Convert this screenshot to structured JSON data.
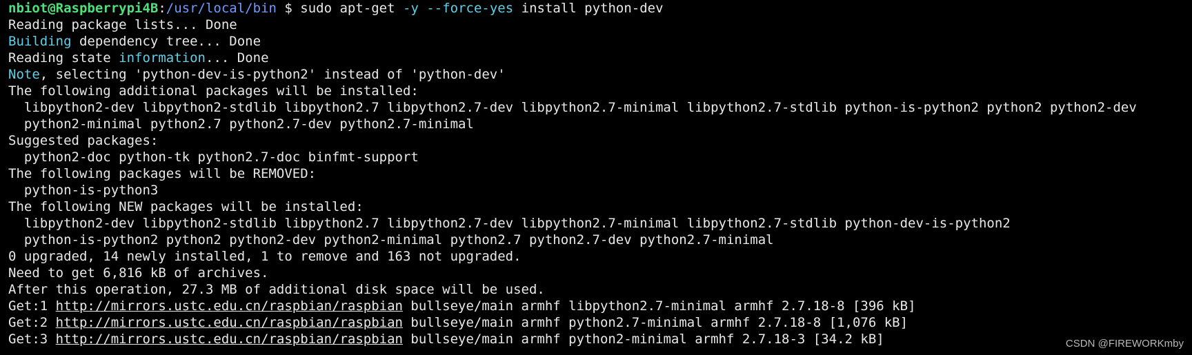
{
  "terminal": {
    "lines": [
      [
        {
          "t": "nbiot@Raspberrypi4B",
          "s": "prompt-user"
        },
        {
          "t": ":",
          "s": "text"
        },
        {
          "t": "/usr/local/bin",
          "s": "prompt-path"
        },
        {
          "t": " $ ",
          "s": "text"
        },
        {
          "t": "sudo apt-get ",
          "s": "text"
        },
        {
          "t": "-y",
          "s": "flag"
        },
        {
          "t": " ",
          "s": "text"
        },
        {
          "t": "--force-yes",
          "s": "flag"
        },
        {
          "t": " install python-dev",
          "s": "text"
        }
      ],
      [
        {
          "t": "Reading package lists... Done",
          "s": "text"
        }
      ],
      [
        {
          "t": "Building",
          "s": "key"
        },
        {
          "t": " dependency tree... Done",
          "s": "text"
        }
      ],
      [
        {
          "t": "Reading state ",
          "s": "text"
        },
        {
          "t": "information",
          "s": "key"
        },
        {
          "t": "... Done",
          "s": "text"
        }
      ],
      [
        {
          "t": "Note",
          "s": "key"
        },
        {
          "t": ", selecting 'python-dev-is-python2' instead of 'python-dev'",
          "s": "text"
        }
      ],
      [
        {
          "t": "The following additional packages will be installed:",
          "s": "text"
        }
      ],
      [
        {
          "t": "  libpython2-dev libpython2-stdlib libpython2.7 libpython2.7-dev libpython2.7-minimal libpython2.7-stdlib python-is-python2 python2 python2-dev",
          "s": "text"
        }
      ],
      [
        {
          "t": "  python2-minimal python2.7 python2.7-dev python2.7-minimal",
          "s": "text"
        }
      ],
      [
        {
          "t": "Suggested packages:",
          "s": "text"
        }
      ],
      [
        {
          "t": "  python2-doc python-tk python2.7-doc binfmt-support",
          "s": "text"
        }
      ],
      [
        {
          "t": "The following packages will be REMOVED:",
          "s": "text"
        }
      ],
      [
        {
          "t": "  python-is-python3",
          "s": "text"
        }
      ],
      [
        {
          "t": "The following NEW packages will be installed:",
          "s": "text"
        }
      ],
      [
        {
          "t": "  libpython2-dev libpython2-stdlib libpython2.7 libpython2.7-dev libpython2.7-minimal libpython2.7-stdlib python-dev-is-python2",
          "s": "text"
        }
      ],
      [
        {
          "t": "  python-is-python2 python2 python2-dev python2-minimal python2.7 python2.7-dev python2.7-minimal",
          "s": "text"
        }
      ],
      [
        {
          "t": "0 upgraded, 14 newly installed, 1 to remove and 163 not upgraded.",
          "s": "text"
        }
      ],
      [
        {
          "t": "Need to get 6,816 kB of archives.",
          "s": "text"
        }
      ],
      [
        {
          "t": "After this operation, 27.3 MB of additional disk space will be used.",
          "s": "text"
        }
      ],
      [
        {
          "t": "Get:1 ",
          "s": "text"
        },
        {
          "t": "http://mirrors.ustc.edu.cn/raspbian/raspbian",
          "s": "link"
        },
        {
          "t": " bullseye/main armhf libpython2.7-minimal armhf 2.7.18-8 [396 kB]",
          "s": "text"
        }
      ],
      [
        {
          "t": "Get:2 ",
          "s": "text"
        },
        {
          "t": "http://mirrors.ustc.edu.cn/raspbian/raspbian",
          "s": "link"
        },
        {
          "t": " bullseye/main armhf python2.7-minimal armhf 2.7.18-8 [1,076 kB]",
          "s": "text"
        }
      ],
      [
        {
          "t": "Get:3 ",
          "s": "text"
        },
        {
          "t": "http://mirrors.ustc.edu.cn/raspbian/raspbian",
          "s": "link"
        },
        {
          "t": " bullseye/main armhf python2-minimal armhf 2.7.18-3 [34.2 kB]",
          "s": "text"
        }
      ]
    ]
  },
  "watermark": "CSDN @FIREWORKmby",
  "colors": {
    "background": "#000000",
    "text": "#e8e8e8",
    "prompt_user": "#4ee07a",
    "prompt_path": "#6f9bff",
    "keyword": "#5fd0e8"
  }
}
